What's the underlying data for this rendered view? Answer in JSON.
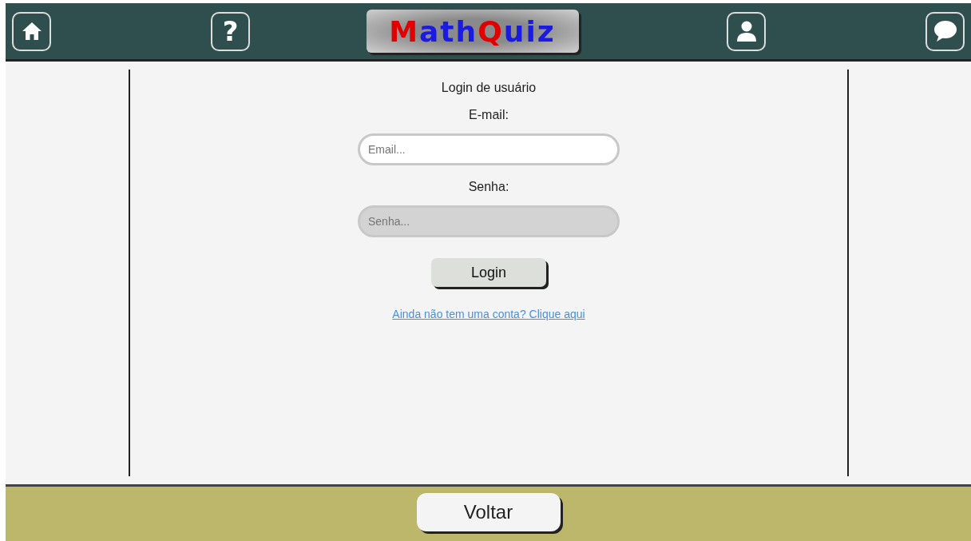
{
  "header": {
    "nav_left": [
      {
        "kind": "home"
      },
      {
        "kind": "help",
        "label": "?"
      }
    ],
    "logo": [
      {
        "text": "M",
        "color": "#e00000"
      },
      {
        "text": "ath",
        "color": "#1a1ae0"
      },
      {
        "text": "Q",
        "color": "#e00000"
      },
      {
        "text": "uiz",
        "color": "#1a1ae0"
      }
    ],
    "nav_right": [
      {
        "kind": "user"
      },
      {
        "kind": "chat"
      }
    ]
  },
  "form": {
    "title": "Login de usuário",
    "fields": [
      {
        "label": "E-mail:",
        "placeholder": "Email...",
        "disabled": false
      },
      {
        "label": "Senha:",
        "placeholder": "Senha...",
        "disabled": true
      }
    ],
    "submit": "Login",
    "signup_link": "Ainda não tem uma conta? Clique aqui"
  },
  "footer": {
    "back_button": "Voltar"
  }
}
